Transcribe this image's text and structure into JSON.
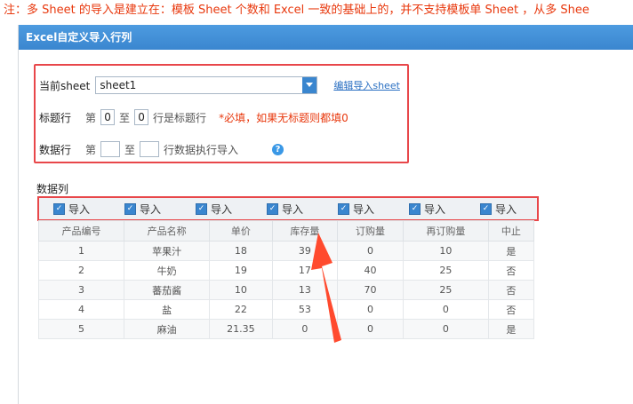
{
  "note": "注：多 Sheet 的导入是建立在：模板 Sheet 个数和 Excel 一致的基础上的，并不支持模板单 Sheet ，从多 Shee",
  "dialog": {
    "title": "Excel自定义导入行列"
  },
  "sheet_row": {
    "label": "当前sheet",
    "value": "sheet1",
    "edit_link": "编辑导入sheet"
  },
  "title_row": {
    "label": "标题行",
    "prefix": "第",
    "from": "0",
    "to_label": "至",
    "to": "0",
    "suffix": "行是标题行",
    "required_note": "*必填，如果无标题则都填0"
  },
  "data_row": {
    "label": "数据行",
    "prefix": "第",
    "from": "",
    "to_label": "至",
    "to": "",
    "suffix": "行数据执行导入",
    "help_icon": "question-circle-icon"
  },
  "columns_label": "数据列",
  "import_checks": [
    {
      "label": "导入",
      "checked": true
    },
    {
      "label": "导入",
      "checked": true
    },
    {
      "label": "导入",
      "checked": true
    },
    {
      "label": "导入",
      "checked": true
    },
    {
      "label": "导入",
      "checked": true
    },
    {
      "label": "导入",
      "checked": true
    },
    {
      "label": "导入",
      "checked": true
    }
  ],
  "table": {
    "headers": [
      "产品编号",
      "产品名称",
      "单价",
      "库存量",
      "订购量",
      "再订购量",
      "中止"
    ],
    "rows": [
      [
        "1",
        "苹果汁",
        "18",
        "39",
        "0",
        "10",
        "是"
      ],
      [
        "2",
        "牛奶",
        "19",
        "17",
        "40",
        "25",
        "否"
      ],
      [
        "3",
        "蕃茄酱",
        "10",
        "13",
        "70",
        "25",
        "否"
      ],
      [
        "4",
        "盐",
        "22",
        "53",
        "0",
        "0",
        "否"
      ],
      [
        "5",
        "麻油",
        "21.35",
        "0",
        "0",
        "0",
        "是"
      ]
    ]
  },
  "colors": {
    "accent": "#3a86cf",
    "highlight": "#e8474a",
    "note": "#e8380d"
  }
}
